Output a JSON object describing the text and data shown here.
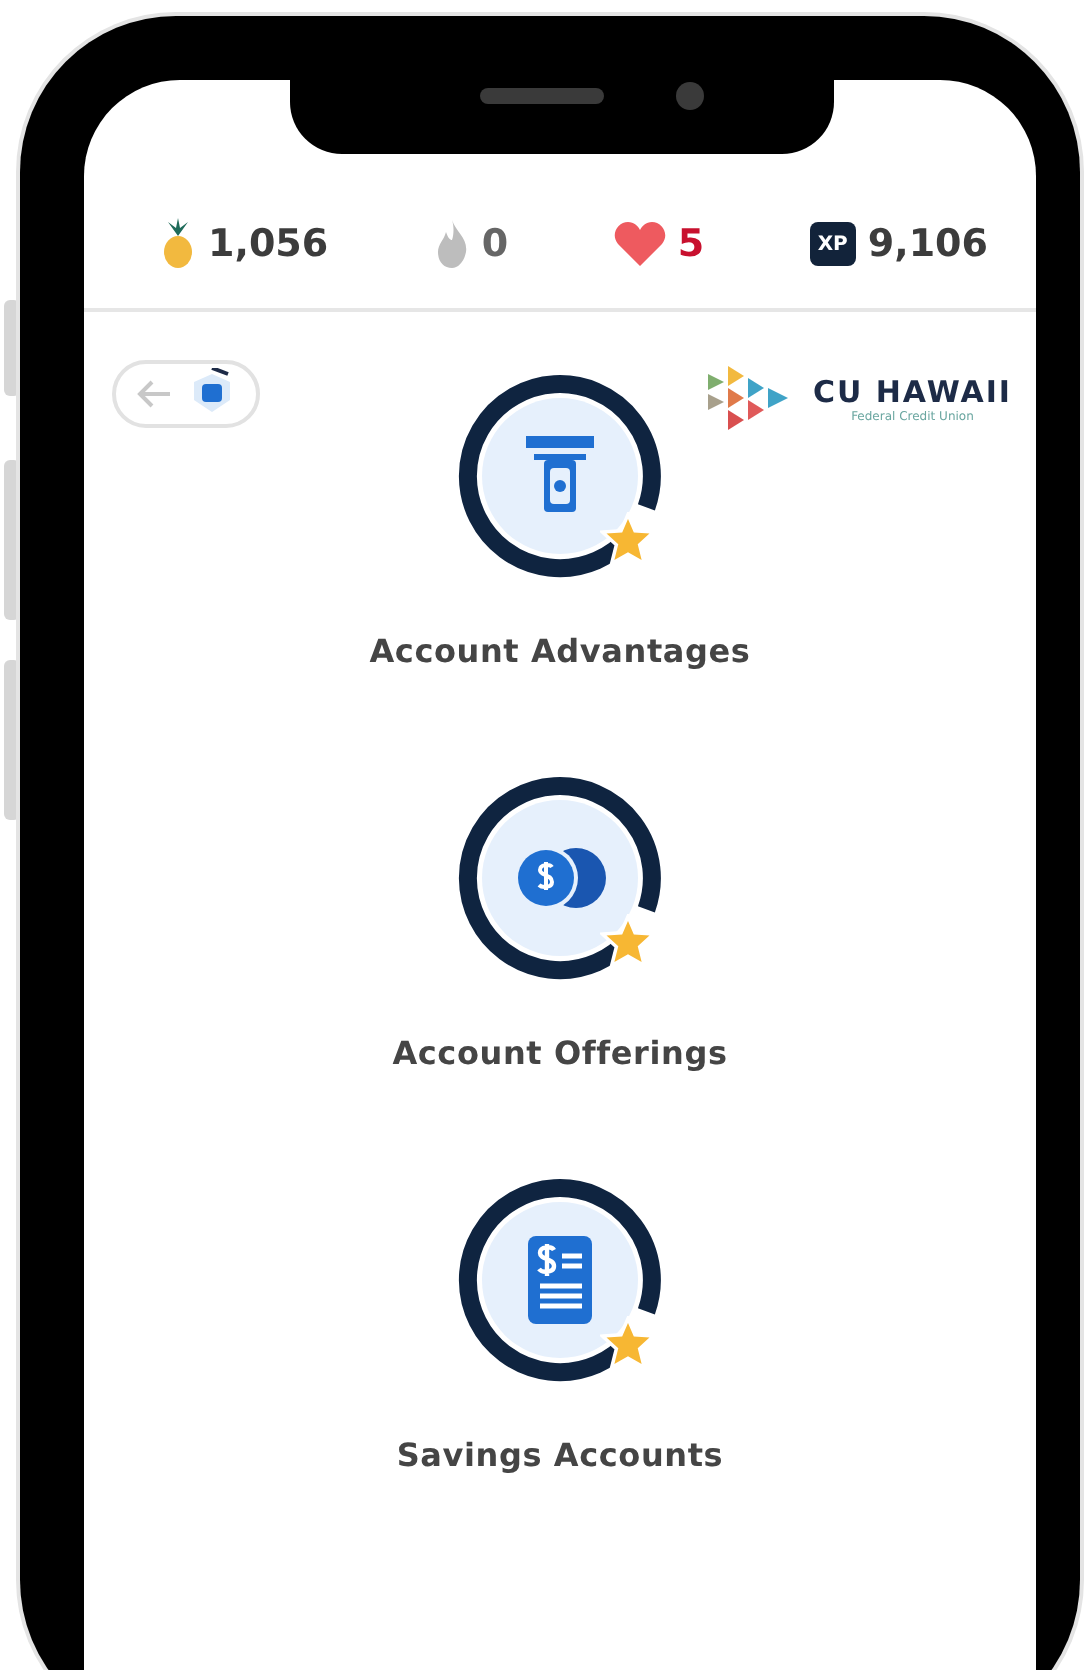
{
  "stats": [
    {
      "kind": "pineapple",
      "value": "1,056"
    },
    {
      "kind": "flame",
      "value": "0"
    },
    {
      "kind": "heart",
      "value": "5"
    },
    {
      "kind": "xp",
      "value": "9,106",
      "badge": "XP"
    }
  ],
  "logo": {
    "name": "CU HAWAII",
    "tagline": "Federal Credit Union"
  },
  "lessons": [
    {
      "kind": "atm",
      "title": "Account Advantages"
    },
    {
      "kind": "coins",
      "title": "Account Offerings"
    },
    {
      "kind": "document",
      "title": "Savings Accounts"
    }
  ]
}
